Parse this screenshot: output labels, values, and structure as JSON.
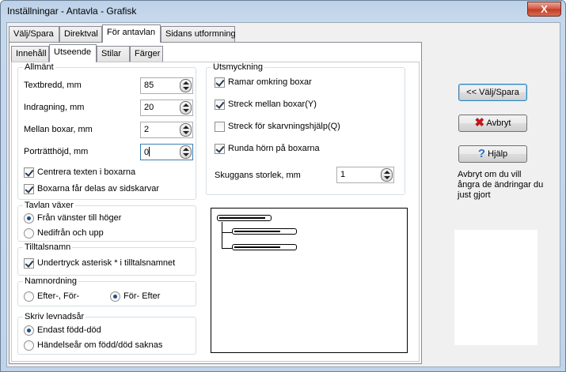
{
  "window": {
    "title": "Inställningar - Antavla - Grafisk",
    "close": "X"
  },
  "outer_tabs": [
    "Välj/Spara",
    "Direktval",
    "För antavlan",
    "Sidans utformning"
  ],
  "inner_tabs": [
    "Innehåll",
    "Utseende",
    "Stilar",
    "Färger"
  ],
  "allmant": {
    "title": "Allmänt",
    "textbredd": {
      "label": "Textbredd, mm",
      "value": "85"
    },
    "indragning": {
      "label": "Indragning, mm",
      "value": "20"
    },
    "mellan": {
      "label": "Mellan boxar, mm",
      "value": "2"
    },
    "portratt": {
      "label": "Porträtthöjd, mm",
      "value": "0"
    },
    "centrera": {
      "label": "Centrera texten i boxarna",
      "checked": true
    },
    "delas": {
      "label": "Boxarna får delas av sidskarvar",
      "checked": true
    }
  },
  "tavlan": {
    "title": "Tavlan växer",
    "opt1": "Från vänster till höger",
    "opt2": "Nedifrån och upp",
    "selected": "opt1"
  },
  "tilltal": {
    "title": "Tilltalsnamn",
    "label": "Undertryck asterisk * i tilltalsnamnet",
    "checked": true
  },
  "namn": {
    "title": "Namnordning",
    "opt1": "Efter-, För-",
    "opt2": "För- Efter",
    "selected": "opt2"
  },
  "levnad": {
    "title": "Skriv levnadsår",
    "opt1": "Endast född-död",
    "opt2": "Händelseår om född/död saknas",
    "selected": "opt1"
  },
  "utsmyckning": {
    "title": "Utsmyckning",
    "ramar": {
      "label": "Ramar omkring boxar",
      "checked": true
    },
    "streck": {
      "label": "Streck mellan boxar(Y)",
      "checked": true
    },
    "skarv": {
      "label": "Streck för skarvningshjälp(Q)",
      "checked": false
    },
    "runda": {
      "label": "Runda hörn på boxarna",
      "checked": true
    },
    "skugga": {
      "label": "Skuggans storlek, mm",
      "value": "1"
    }
  },
  "buttons": {
    "valj": "<< Välj/Spara",
    "avbryt": "Avbryt",
    "hjalp": "Hjälp"
  },
  "help_text": "Avbryt om du vill ångra de ändringar du just gjort",
  "icons": {
    "cancel": "red-x-icon",
    "help": "question-mark-icon"
  },
  "colors": {
    "cancel_icon": "#c0161a",
    "help_icon": "#2a6fd0",
    "title_bar": "#bcd1e8"
  }
}
